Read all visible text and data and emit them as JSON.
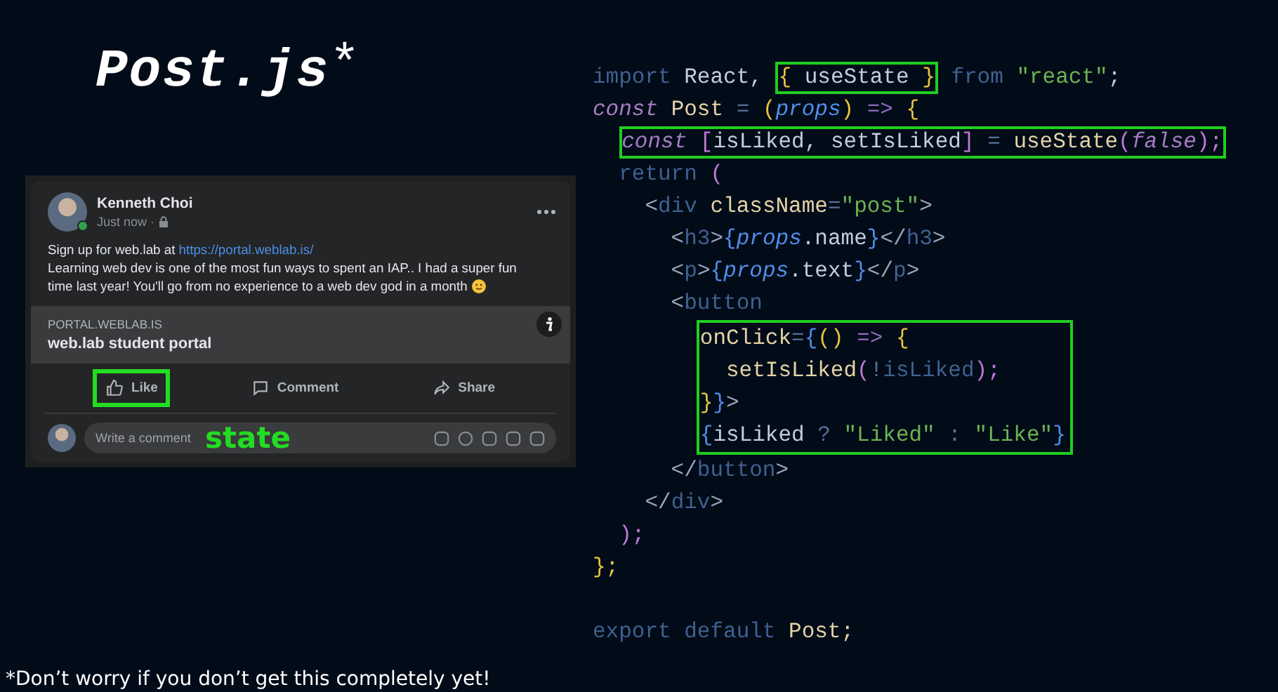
{
  "title": {
    "text": "Post.js",
    "mark": "*"
  },
  "post": {
    "author": "Kenneth Choi",
    "time": "Just now ·",
    "online": true,
    "text": [
      {
        "text": "Sign up for web.lab at ",
        "link": "https://portal.weblab.is/"
      },
      {
        "lines": [
          "Learning web dev is one of the most fun ways to spent an IAP.. I had a super fun",
          "time last year! You'll go from no experience to a web dev god in a month"
        ]
      }
    ],
    "preview": {
      "domain": "PORTAL.WEBLAB.IS",
      "title": "web.lab student portal"
    },
    "actions": [
      {
        "kind": "like",
        "label": "Like",
        "highlighted": true
      },
      {
        "kind": "comment",
        "label": "Comment",
        "highlighted": false
      },
      {
        "kind": "share",
        "label": "Share",
        "highlighted": false
      }
    ],
    "comment": {
      "placeholder": "Write a comment",
      "annotation": "state"
    }
  },
  "code": [
    {
      "kind": "line",
      "boxed": false,
      "tokens": [
        {
          "text": "import ",
          "kind": "keyword"
        },
        {
          "text": "React, ",
          "kind": "plain"
        },
        {
          "kind": "boxed",
          "tokens": [
            {
              "text": "{ ",
              "kind": "brace"
            },
            {
              "text": "useState",
              "kind": "plain"
            },
            {
              "text": " }",
              "kind": "brace"
            }
          ]
        },
        {
          "text": " from ",
          "kind": "keyword"
        },
        {
          "text": "\"react\"",
          "kind": "string"
        },
        {
          "text": ";",
          "kind": "plain"
        }
      ]
    },
    {
      "kind": "line",
      "boxed": false,
      "tokens": [
        {
          "text": "const ",
          "kind": "storage"
        },
        {
          "text": "Post ",
          "kind": "ident"
        },
        {
          "text": "= ",
          "kind": "punct"
        },
        {
          "text": "(",
          "kind": "brace"
        },
        {
          "text": "props",
          "kind": "param"
        },
        {
          "text": ") ",
          "kind": "brace"
        },
        {
          "text": "=> ",
          "kind": "op"
        },
        {
          "text": "{",
          "kind": "brace"
        }
      ]
    },
    {
      "kind": "line",
      "boxed": true,
      "tokens": [
        {
          "text": "  const ",
          "kind": "storage"
        },
        {
          "text": "[",
          "kind": "bracket"
        },
        {
          "text": "isLiked, setIsLiked",
          "kind": "plain"
        },
        {
          "text": "] ",
          "kind": "bracket"
        },
        {
          "text": "= ",
          "kind": "punct"
        },
        {
          "text": "useState",
          "kind": "ident"
        },
        {
          "text": "(",
          "kind": "bracket"
        },
        {
          "text": "false",
          "kind": "storage"
        },
        {
          "text": ");",
          "kind": "bracket"
        }
      ]
    },
    {
      "kind": "line",
      "boxed": false,
      "tokens": [
        {
          "text": "  return ",
          "kind": "keyword"
        },
        {
          "text": "(",
          "kind": "bracket"
        }
      ]
    },
    {
      "kind": "line",
      "boxed": false,
      "tokens": [
        {
          "text": "    <",
          "kind": "tag"
        },
        {
          "text": "div ",
          "kind": "keyword"
        },
        {
          "text": "className",
          "kind": "ident"
        },
        {
          "text": "=",
          "kind": "punct"
        },
        {
          "text": "\"post\"",
          "kind": "string"
        },
        {
          "text": ">",
          "kind": "tag"
        }
      ]
    },
    {
      "kind": "line",
      "boxed": false,
      "tokens": [
        {
          "text": "      <",
          "kind": "tag"
        },
        {
          "text": "h3",
          "kind": "keyword"
        },
        {
          "text": ">",
          "kind": "tag"
        },
        {
          "text": "{",
          "kind": "jsx"
        },
        {
          "text": "props",
          "kind": "param"
        },
        {
          "text": ".name",
          "kind": "plain"
        },
        {
          "text": "}",
          "kind": "jsx"
        },
        {
          "text": "</",
          "kind": "tag"
        },
        {
          "text": "h3",
          "kind": "keyword"
        },
        {
          "text": ">",
          "kind": "tag"
        }
      ]
    },
    {
      "kind": "line",
      "boxed": false,
      "tokens": [
        {
          "text": "      <",
          "kind": "tag"
        },
        {
          "text": "p",
          "kind": "keyword"
        },
        {
          "text": ">",
          "kind": "tag"
        },
        {
          "text": "{",
          "kind": "jsx"
        },
        {
          "text": "props",
          "kind": "param"
        },
        {
          "text": ".text",
          "kind": "plain"
        },
        {
          "text": "}",
          "kind": "jsx"
        },
        {
          "text": "</",
          "kind": "tag"
        },
        {
          "text": "p",
          "kind": "keyword"
        },
        {
          "text": ">",
          "kind": "tag"
        }
      ]
    },
    {
      "kind": "line",
      "boxed": false,
      "tokens": [
        {
          "text": "      <",
          "kind": "tag"
        },
        {
          "text": "button",
          "kind": "keyword"
        }
      ]
    },
    {
      "kind": "group",
      "boxed": true,
      "lines": [
        {
          "tokens": [
            {
              "text": "        onClick",
              "kind": "ident"
            },
            {
              "text": "=",
              "kind": "punct"
            },
            {
              "text": "{",
              "kind": "jsx"
            },
            {
              "text": "() ",
              "kind": "brace"
            },
            {
              "text": "=> ",
              "kind": "op"
            },
            {
              "text": "{",
              "kind": "brace"
            }
          ]
        },
        {
          "tokens": [
            {
              "text": "          setIsLiked",
              "kind": "ident"
            },
            {
              "text": "(",
              "kind": "bracket"
            },
            {
              "text": "!",
              "kind": "punct"
            },
            {
              "text": "isLiked",
              "kind": "keyword"
            },
            {
              "text": ");",
              "kind": "bracket"
            }
          ]
        },
        {
          "tokens": [
            {
              "text": "        }",
              "kind": "brace"
            },
            {
              "text": "}",
              "kind": "jsx"
            },
            {
              "text": ">",
              "kind": "tag"
            }
          ]
        },
        {
          "tokens": [
            {
              "text": "        {",
              "kind": "jsx"
            },
            {
              "text": "isLiked ",
              "kind": "plain"
            },
            {
              "text": "? ",
              "kind": "punct"
            },
            {
              "text": "\"Liked\" ",
              "kind": "string"
            },
            {
              "text": ": ",
              "kind": "punct"
            },
            {
              "text": "\"Like\"",
              "kind": "string"
            },
            {
              "text": "}",
              "kind": "jsx"
            }
          ]
        }
      ]
    },
    {
      "kind": "line",
      "boxed": false,
      "tokens": [
        {
          "text": "      </",
          "kind": "tag"
        },
        {
          "text": "button",
          "kind": "keyword"
        },
        {
          "text": ">",
          "kind": "tag"
        }
      ]
    },
    {
      "kind": "line",
      "boxed": false,
      "tokens": [
        {
          "text": "    </",
          "kind": "tag"
        },
        {
          "text": "div",
          "kind": "keyword"
        },
        {
          "text": ">",
          "kind": "tag"
        }
      ]
    },
    {
      "kind": "line",
      "boxed": false,
      "tokens": [
        {
          "text": "  );",
          "kind": "bracket"
        }
      ]
    },
    {
      "kind": "line",
      "boxed": false,
      "tokens": [
        {
          "text": "};",
          "kind": "brace"
        }
      ]
    },
    {
      "kind": "blank"
    },
    {
      "kind": "line",
      "boxed": false,
      "tokens": [
        {
          "text": "export default ",
          "kind": "keyword"
        },
        {
          "text": "Post;",
          "kind": "ident"
        }
      ]
    }
  ],
  "footnote": "*Don’t worry if you don’t get this completely yet!"
}
